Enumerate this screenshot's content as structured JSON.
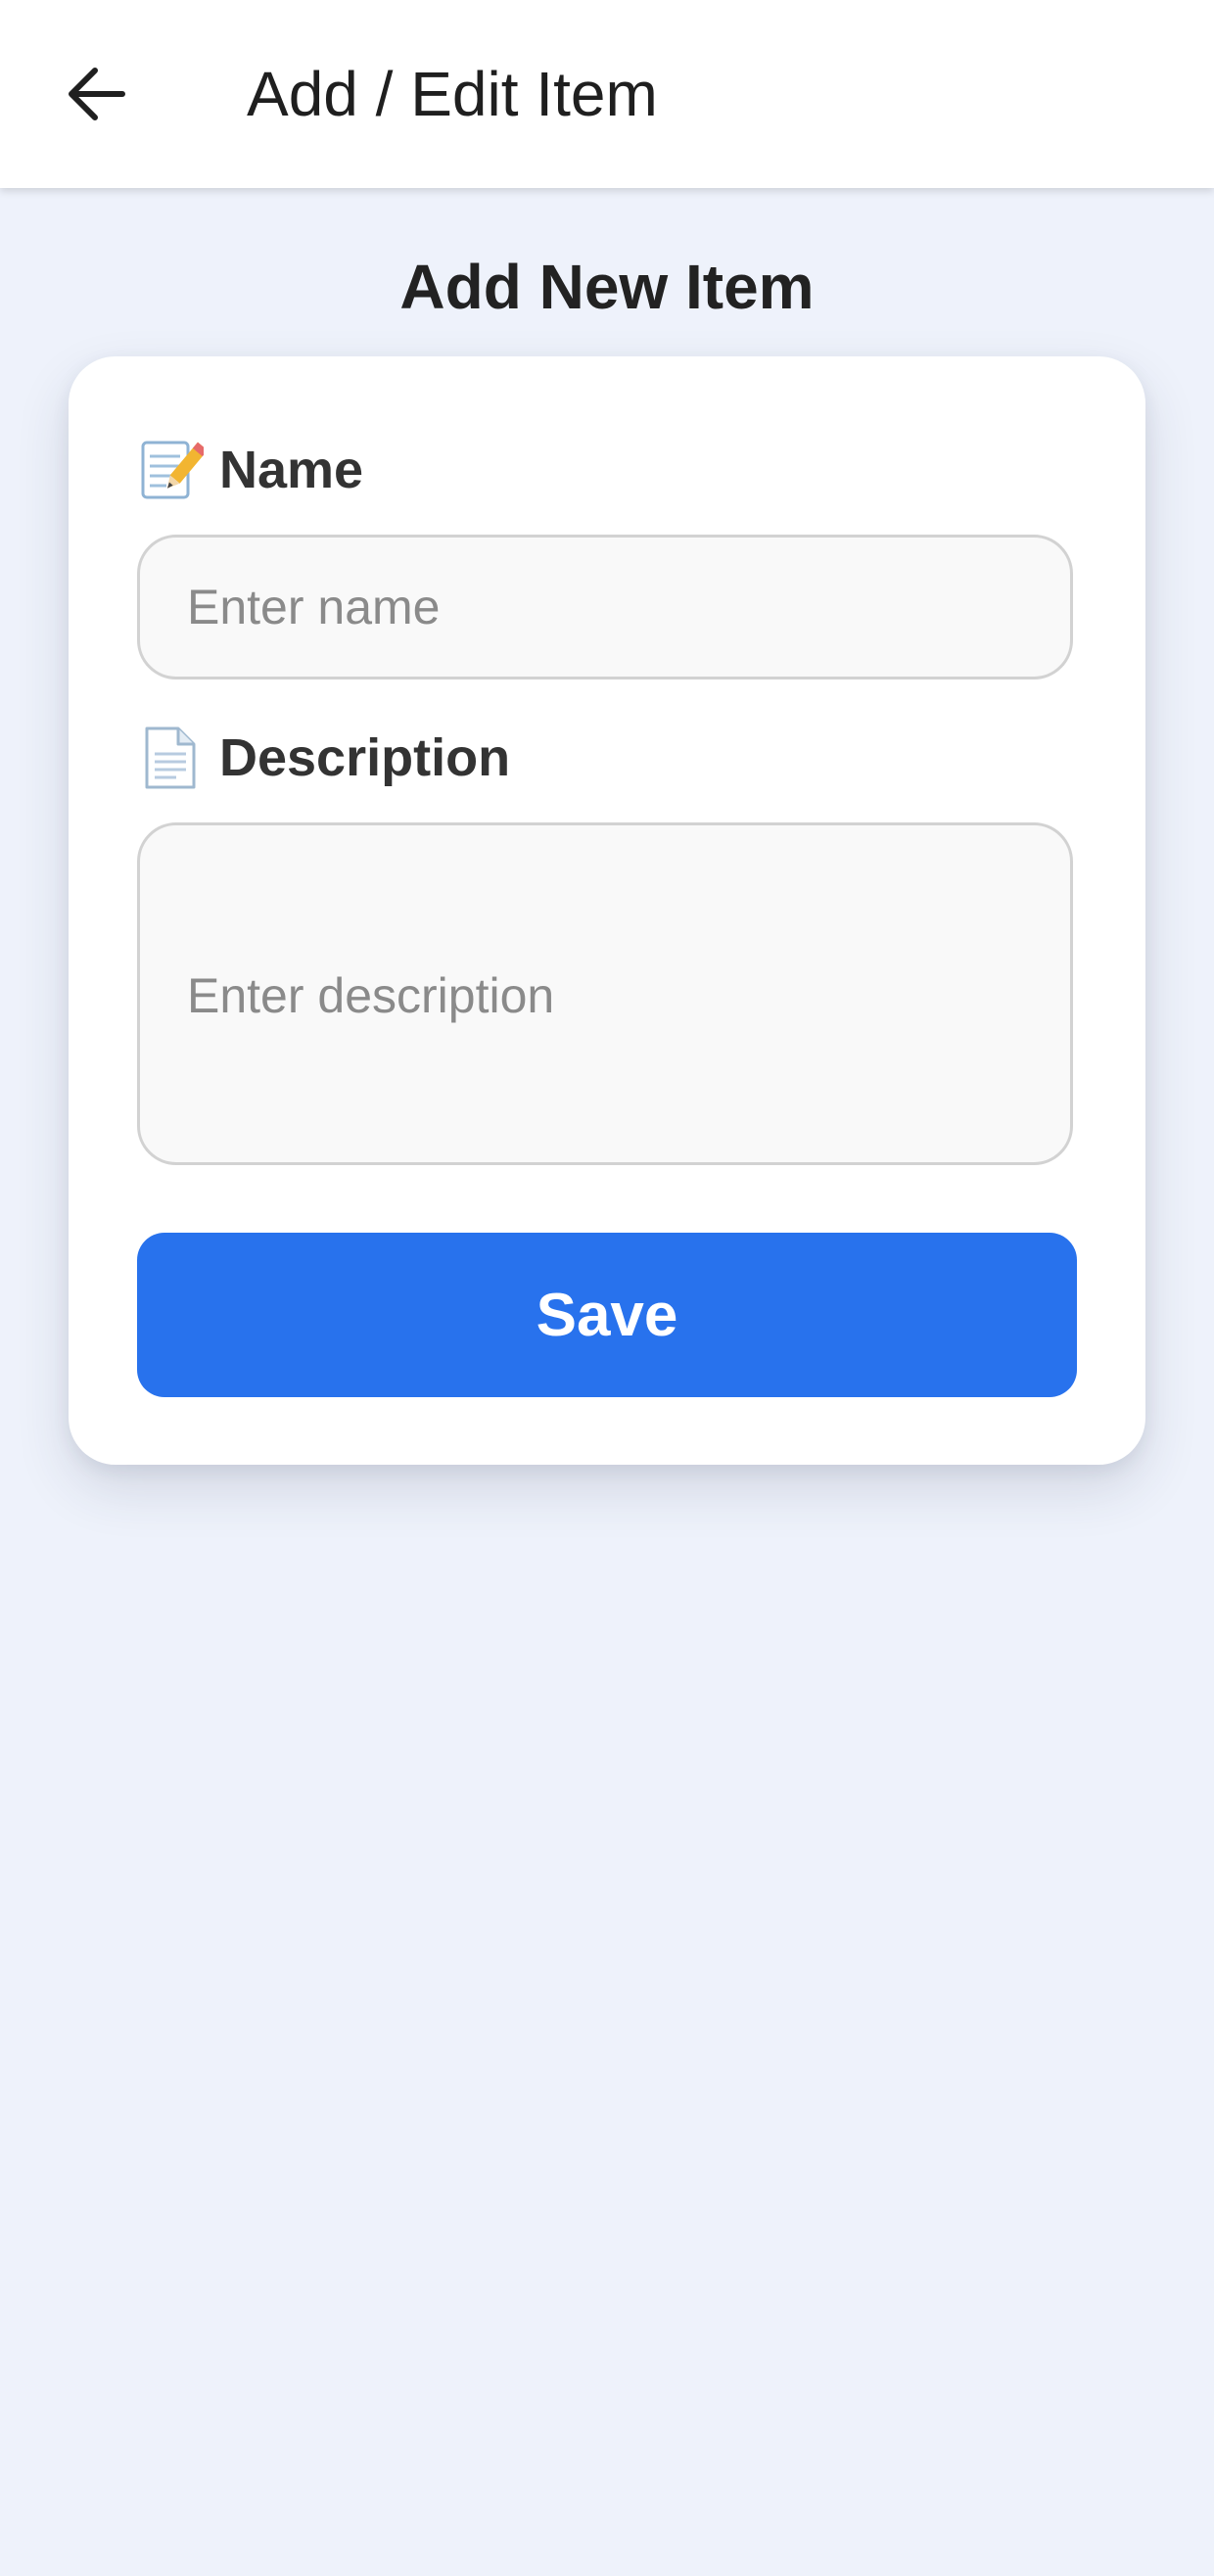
{
  "app_bar": {
    "back_icon": "arrow-left-icon",
    "title": "Add / Edit Item"
  },
  "page": {
    "heading": "Add New Item"
  },
  "form": {
    "name": {
      "icon": "memo-pencil-icon",
      "label": "Name",
      "placeholder": "Enter name",
      "value": ""
    },
    "description": {
      "icon": "document-icon",
      "label": "Description",
      "placeholder": "Enter description",
      "value": ""
    },
    "save_label": "Save"
  },
  "colors": {
    "background": "#eef2fb",
    "app_bar": "#ffffff",
    "primary": "#2872ed",
    "input_background": "#f9f9f9",
    "input_border": "#d2d2d2"
  }
}
